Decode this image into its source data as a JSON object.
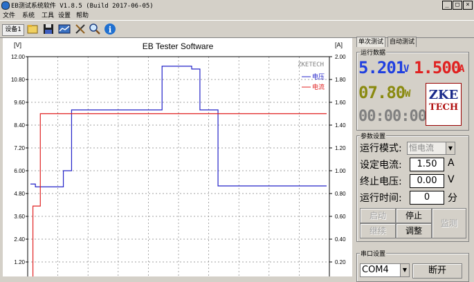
{
  "window": {
    "title": "EB测试系统软件 V1.8.5 (Build 2017-06-05)"
  },
  "menu": [
    "文件",
    "系统",
    "工具",
    "设置",
    "帮助"
  ],
  "toolbar": {
    "device_tab": "设备1"
  },
  "chart": {
    "title": "EB Tester Software",
    "left_unit": "[V]",
    "right_unit": "[A]",
    "watermark": "ZKETECH",
    "legend_voltage": "电压",
    "legend_current": "电流",
    "left_ticks": [
      "12.00",
      "10.80",
      "9.60",
      "8.40",
      "7.20",
      "6.00",
      "4.80",
      "3.60",
      "2.40",
      "1.20"
    ],
    "right_ticks": [
      "2.00",
      "1.80",
      "1.60",
      "1.40",
      "1.20",
      "1.00",
      "0.80",
      "0.60",
      "0.40",
      "0.20"
    ],
    "voltage_color": "#2121c8",
    "current_color": "#e02020"
  },
  "chart_data": {
    "type": "line",
    "title": "EB Tester Software",
    "ylabel": "[V]",
    "ylabel_right": "[A]",
    "ylim": [
      0,
      12
    ],
    "ylim_right": [
      0,
      2
    ],
    "grid": true,
    "legend": "top-right",
    "series": [
      {
        "name": "电压",
        "axis": "left",
        "x": [
          0,
          0.3,
          0.3,
          2.0,
          2.0,
          2.5,
          2.5,
          8.0,
          8.0,
          9.8,
          9.8,
          10.3,
          10.3,
          11.4,
          11.4,
          13.3,
          13.3,
          18.0
        ],
        "values": [
          5.3,
          5.3,
          5.15,
          5.15,
          6.0,
          6.0,
          9.2,
          9.2,
          11.5,
          11.5,
          11.35,
          11.35,
          9.2,
          9.2,
          5.2,
          5.2,
          5.2,
          5.2
        ]
      },
      {
        "name": "电流",
        "axis": "right",
        "x": [
          0,
          0.15,
          0.15,
          0.6,
          0.6,
          18.0
        ],
        "values": [
          0,
          0,
          0.69,
          0.69,
          1.5,
          1.5
        ]
      }
    ]
  },
  "right_panel": {
    "tab_single": "单次测试",
    "tab_auto": "自动测试",
    "run_data_label": "运行数据",
    "voltage_value": "5.201",
    "voltage_unit": "V",
    "current_value": "1.500",
    "current_unit": "A",
    "power_value": "07.80",
    "power_unit": "W",
    "time_value": "00:00:00",
    "logo_top": "ZKE",
    "logo_bottom": "TECH",
    "param_label": "参数设置",
    "mode_label": "运行模式:",
    "mode_value": "恒电流",
    "set_current_label": "设定电流:",
    "set_current_value": "1.50",
    "set_current_unit": "A",
    "stop_voltage_label": "终止电压:",
    "stop_voltage_value": "0.00",
    "stop_voltage_unit": "V",
    "run_time_label": "运行时间:",
    "run_time_value": "0",
    "run_time_unit": "分",
    "btn_start": "启动",
    "btn_stop": "停止",
    "btn_monitor": "监测",
    "btn_continue": "继续",
    "btn_adjust": "调整",
    "serial_label": "串口设置",
    "com_port": "COM4",
    "btn_disconnect": "断开"
  }
}
